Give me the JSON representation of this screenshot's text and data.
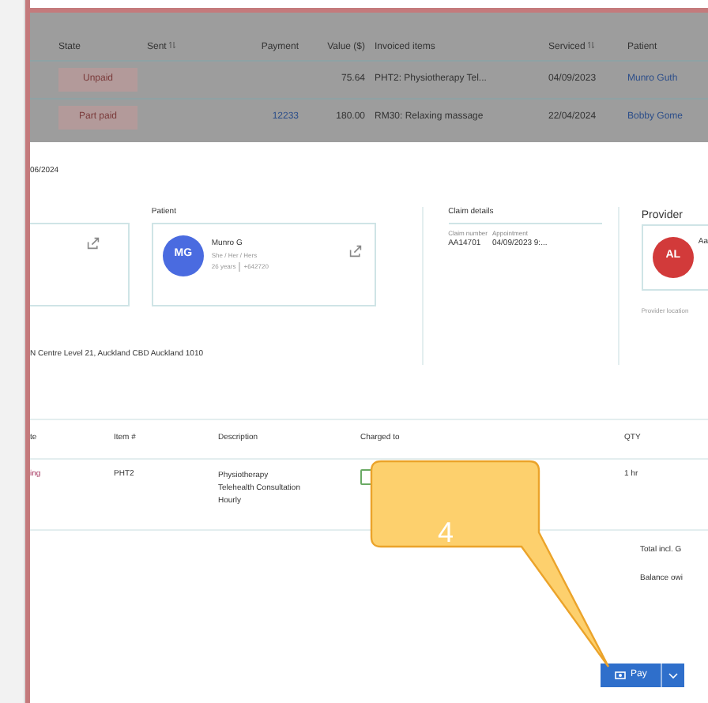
{
  "invoice_list": {
    "columns": [
      {
        "label": "State",
        "sortable": false
      },
      {
        "label": "Sent",
        "sortable": true
      },
      {
        "label": "Payment",
        "sortable": false
      },
      {
        "label": "Value ($)",
        "sortable": false
      },
      {
        "label": "Invoiced items",
        "sortable": false
      },
      {
        "label": "Serviced",
        "sortable": true
      },
      {
        "label": "Patient",
        "sortable": false
      }
    ],
    "rows": [
      {
        "state": "Unpaid",
        "payment": "",
        "value": "75.64",
        "items": "PHT2:  Physiotherapy Tel...",
        "serviced": "04/09/2023",
        "patient": "Munro Guth"
      },
      {
        "state": "Part paid",
        "payment": "12233",
        "value": "180.00",
        "items": "RM30:  Relaxing massage",
        "serviced": "22/04/2024",
        "patient": "Bobby Gome"
      }
    ]
  },
  "date": "06/2024",
  "patient": {
    "label": "Patient",
    "initials": "MG",
    "name": "Munro G",
    "pronouns": "She / Her / Hers",
    "age": "26 years",
    "phone": "+642720"
  },
  "claim": {
    "label": "Claim details",
    "fields": [
      {
        "label": "Claim number",
        "value": "AA14701"
      },
      {
        "label": "Appointment",
        "value": "04/09/2023 9:..."
      }
    ]
  },
  "provider": {
    "label": "Provider",
    "initials": "AL",
    "name": "Aa",
    "location_label": "Provider location"
  },
  "address": "N Centre Level 21, Auckland CBD Auckland 1010",
  "items": {
    "columns": [
      "te",
      "Item #",
      "Description",
      "Charged to",
      "QTY"
    ],
    "rows": [
      {
        "state": "ing",
        "item": "PHT2",
        "description": "Physiotherapy Telehealth Consultation Hourly",
        "qty": "1 hr"
      }
    ]
  },
  "totals": [
    "Total incl. G",
    "Balance owi"
  ],
  "callout": "4",
  "pay_button": "Pay"
}
